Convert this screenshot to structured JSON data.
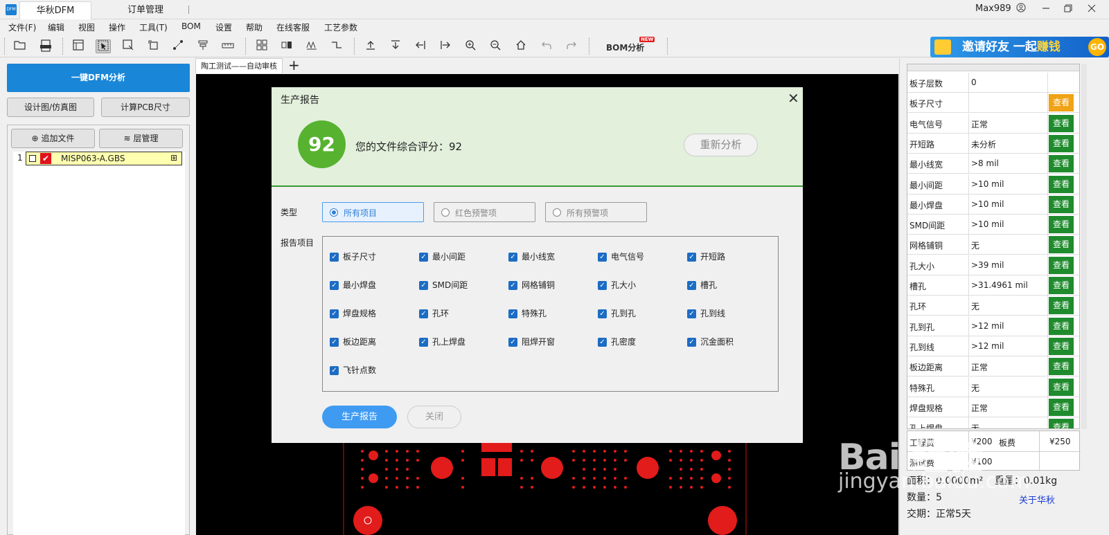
{
  "titlebar": {
    "app_logo": "DFM",
    "active_tab": "华秋DFM",
    "inactive_tab": "订单管理",
    "username": "Max989"
  },
  "menu": [
    "文件(F)",
    "编辑",
    "视图",
    "操作",
    "工具(T)",
    "BOM",
    "设置",
    "帮助",
    "在线客服",
    "工艺参数"
  ],
  "toolbar": {
    "bom_label": "BOM分析",
    "new_badge": "NEW",
    "ad_text_a": "邀请好友 一起",
    "ad_text_b": "赚钱",
    "ad_go": "GO"
  },
  "left": {
    "dfm_button": "一键DFM分析",
    "design_button": "设计图/仿真图",
    "calc_button": "计算PCB尺寸",
    "add_file": "追加文件",
    "layer_manage": "层管理",
    "files": [
      {
        "index": "1",
        "name": "MISP063-A.GBS"
      }
    ]
  },
  "canvas": {
    "doc_tab": "陶工测试——自动审核"
  },
  "dialog": {
    "title": "生产报告",
    "score": "92",
    "score_text": "您的文件综合评分：92",
    "reanalyze": "重新分析",
    "type_label": "类型",
    "radios": [
      "所有项目",
      "红色预警项",
      "所有预警项"
    ],
    "items_label": "报告项目",
    "items": [
      "板子尺寸",
      "最小间距",
      "最小线宽",
      "电气信号",
      "开短路",
      "最小焊盘",
      "SMD间距",
      "网格铺铜",
      "孔大小",
      "槽孔",
      "焊盘规格",
      "孔环",
      "特殊孔",
      "孔到孔",
      "孔到线",
      "板边距离",
      "孔上焊盘",
      "阻焊开窗",
      "孔密度",
      "沉金面积",
      "飞针点数"
    ],
    "generate": "生产报告",
    "close": "关闭"
  },
  "right": {
    "view_label": "查看",
    "rows": [
      {
        "label": "板子层数",
        "value": "0",
        "btn": "none"
      },
      {
        "label": "板子尺寸",
        "value": "",
        "btn": "orange"
      },
      {
        "label": "电气信号",
        "value": "正常",
        "btn": "green"
      },
      {
        "label": "开短路",
        "value": "未分析",
        "btn": "green"
      },
      {
        "label": "最小线宽",
        "value": ">8 mil",
        "btn": "green"
      },
      {
        "label": "最小间距",
        "value": ">10 mil",
        "btn": "green"
      },
      {
        "label": "最小焊盘",
        "value": ">10 mil",
        "btn": "green"
      },
      {
        "label": "SMD间距",
        "value": ">10 mil",
        "btn": "green"
      },
      {
        "label": "网格铺铜",
        "value": "无",
        "btn": "green"
      },
      {
        "label": "孔大小",
        "value": ">39 mil",
        "btn": "green"
      },
      {
        "label": "槽孔",
        "value": ">31.4961 mil",
        "btn": "green"
      },
      {
        "label": "孔环",
        "value": "无",
        "btn": "green"
      },
      {
        "label": "孔到孔",
        "value": ">12 mil",
        "btn": "green"
      },
      {
        "label": "孔到线",
        "value": ">12 mil",
        "btn": "green"
      },
      {
        "label": "板边距离",
        "value": "正常",
        "btn": "green"
      },
      {
        "label": "特殊孔",
        "value": "无",
        "btn": "green"
      },
      {
        "label": "焊盘规格",
        "value": "正常",
        "btn": "green"
      },
      {
        "label": "孔上焊盘",
        "value": "无",
        "btn": "green"
      }
    ],
    "price": {
      "label_a": "工程费",
      "value_a": "¥200",
      "label_b": "板费",
      "value_b": "¥250",
      "label_c": "测试费",
      "value_c": "¥100"
    },
    "area": "面积：0.0000m²",
    "weight": "重量：0.01kg",
    "quantity": "数量：5",
    "delivery": "交期：正常5天",
    "about": "关于华秋"
  },
  "watermark": {
    "text": "Bai 经验",
    "url": "jingyan.baidu.com"
  }
}
